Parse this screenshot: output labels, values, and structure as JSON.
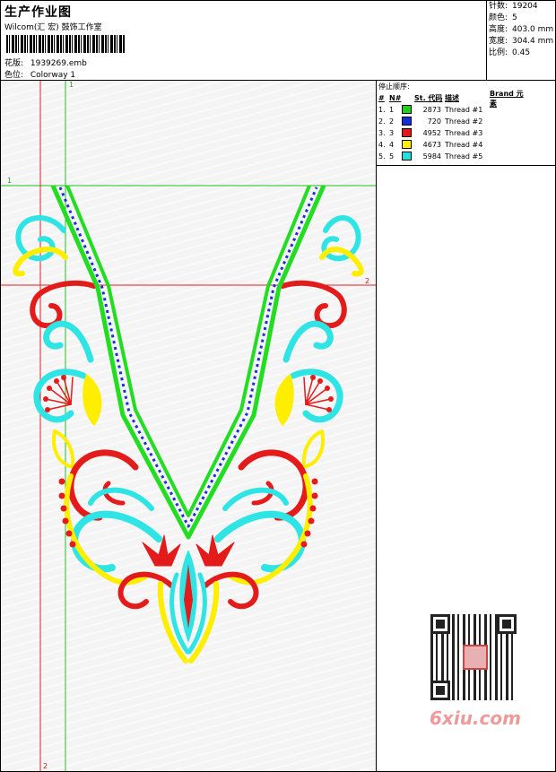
{
  "header": {
    "title": "生产作业图",
    "company": "Wilcom(汇 宏) 鼓饰工作室",
    "design_label": "花版:",
    "design_value": "1939269.emb",
    "color_label": "色位:",
    "color_value": "Colorway 1"
  },
  "stats": [
    {
      "label": "针数:",
      "value": "19204"
    },
    {
      "label": "颜色:",
      "value": "5"
    },
    {
      "label": "高度:",
      "value": "403.0 mm"
    },
    {
      "label": "宽度:",
      "value": "304.4 mm"
    },
    {
      "label": "比例:",
      "value": "0.45"
    }
  ],
  "threads": {
    "title": "停止顺序:",
    "headers": [
      "#",
      "N#",
      "St.",
      "代码",
      "描述",
      "Brand",
      "元素"
    ],
    "rows": [
      {
        "num": "1.",
        "n": "1",
        "code": "2873",
        "desc": "Thread #1",
        "color": "#22cc22"
      },
      {
        "num": "2.",
        "n": "2",
        "code": "720",
        "desc": "Thread #2",
        "color": "#1030e0"
      },
      {
        "num": "3.",
        "n": "3",
        "code": "4952",
        "desc": "Thread #3",
        "color": "#e01a1a"
      },
      {
        "num": "4.",
        "n": "4",
        "code": "4673",
        "desc": "Thread #4",
        "color": "#ffee00"
      },
      {
        "num": "5.",
        "n": "5",
        "code": "5984",
        "desc": "Thread #5",
        "color": "#22e0e0"
      }
    ]
  },
  "guides": {
    "label_1": "1",
    "label_2": "2"
  },
  "watermark": {
    "text": "6xiu.com"
  },
  "colors": {
    "green": "#22dd22",
    "blue": "#1a2ee0",
    "red": "#e41b1b",
    "yellow": "#ffee00",
    "cyan": "#2ee4e4",
    "guide_red": "#e02020",
    "guide_green": "#20c020"
  }
}
